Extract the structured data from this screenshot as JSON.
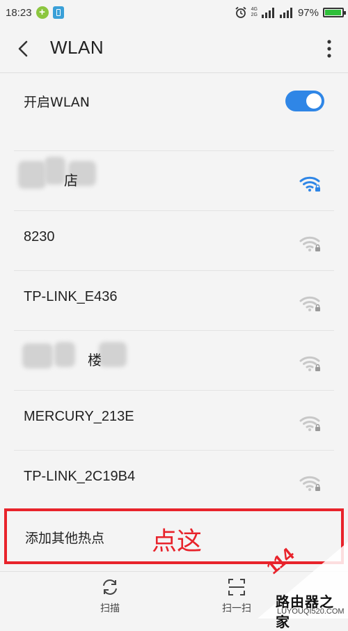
{
  "status_bar": {
    "time": "18:23",
    "network_tag_top": "4G",
    "network_tag_bottom": "2G",
    "battery_percent": "97%",
    "battery_level": 0.97
  },
  "header": {
    "title": "WLAN"
  },
  "wlan_toggle": {
    "label": "开启WLAN",
    "on": true
  },
  "networks": [
    {
      "ssid": "店",
      "secured": true,
      "signal": "full"
    },
    {
      "ssid": "8230",
      "secured": true,
      "signal": "low"
    },
    {
      "ssid": "TP-LINK_E436",
      "secured": true,
      "signal": "low"
    },
    {
      "ssid": "楼",
      "secured": true,
      "signal": "low"
    },
    {
      "ssid": "MERCURY_213E",
      "secured": true,
      "signal": "low"
    },
    {
      "ssid": "TP-LINK_2C19B4",
      "secured": true,
      "signal": "low"
    }
  ],
  "add_hotspot": {
    "label": "添加其他热点",
    "annotation": "点这"
  },
  "bottom_bar": {
    "scan_label": "扫描",
    "qr_label": "扫一扫"
  },
  "watermark": {
    "number": "114",
    "brand": "路由器之家",
    "url": "LUYOUQI520.COM"
  },
  "colors": {
    "accent": "#2f86e6",
    "wifi_strong": "#2f86e6",
    "wifi_weak": "#c8c8c8",
    "highlight": "#e8232b"
  }
}
